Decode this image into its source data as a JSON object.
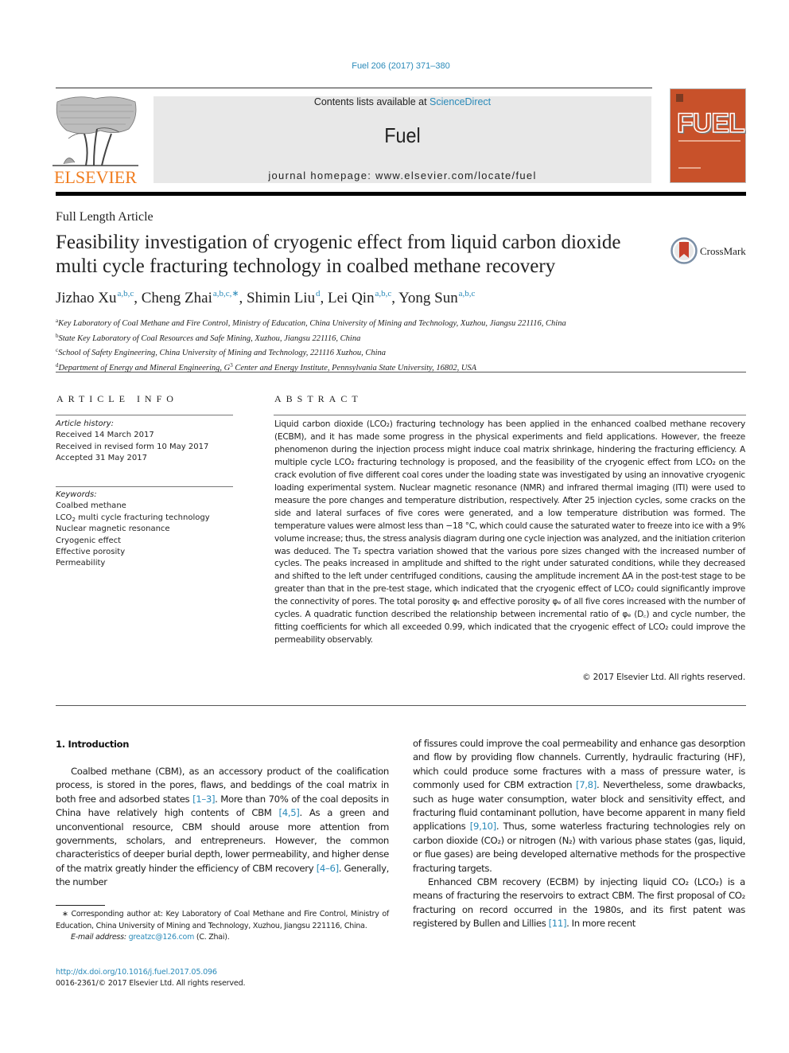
{
  "header": {
    "citation": "Fuel 206 (2017) 371–380",
    "contents_prefix": "Contents lists available at ",
    "contents_link": "ScienceDirect",
    "journal_name": "Fuel",
    "homepage_prefix": "journal homepage: ",
    "homepage_url": "www.elsevier.com/locate/fuel",
    "publisher_logo_text": "ELSEVIER",
    "cover_title": "FUEL",
    "colors": {
      "link": "#2a8ab9",
      "elsevier_orange": "#f07c1e",
      "cover": "#c8512a",
      "banner_bg": "#e8e8e8"
    }
  },
  "article": {
    "type": "Full Length Article",
    "title_line1": "Feasibility investigation of cryogenic effect from liquid carbon dioxide",
    "title_line2": "multi cycle fracturing technology in coalbed methane recovery",
    "crossmark_label": "CrossMark",
    "authors": [
      {
        "name": "Jizhao Xu",
        "sup": "a,b,c"
      },
      {
        "name": "Cheng Zhai",
        "sup": "a,b,c,",
        "corresponding": "∗"
      },
      {
        "name": "Shimin Liu",
        "sup": "d"
      },
      {
        "name": "Lei Qin",
        "sup": "a,b,c"
      },
      {
        "name": "Yong Sun",
        "sup": "a,b,c"
      }
    ],
    "affiliations": [
      {
        "key": "a",
        "text": "Key Laboratory of Coal Methane and Fire Control, Ministry of Education, China University of Mining and Technology, Xuzhou, Jiangsu 221116, China"
      },
      {
        "key": "b",
        "text": "State Key Laboratory of Coal Resources and Safe Mining, Xuzhou, Jiangsu 221116, China"
      },
      {
        "key": "c",
        "text": "School of Safety Engineering, China University of Mining and Technology, 221116 Xuzhou, China"
      },
      {
        "key": "d",
        "text_pre": "Department of Energy and Mineral Engineering, G",
        "text_sup": "3",
        "text_post": " Center and Energy Institute, Pennsylvania State University, 16802, USA"
      }
    ]
  },
  "article_info": {
    "heading": "ARTICLE INFO",
    "history_label": "Article history:",
    "history": [
      "Received 14 March 2017",
      "Received in revised form 10 May 2017",
      "Accepted 31 May 2017"
    ],
    "keywords_label": "Keywords:",
    "keywords": [
      "Coalbed methane",
      "LCO2 multi cycle fracturing technology",
      "Nuclear magnetic resonance",
      "Cryogenic effect",
      "Effective porosity",
      "Permeability"
    ]
  },
  "abstract": {
    "heading": "ABSTRACT",
    "text": "Liquid carbon dioxide (LCO₂) fracturing technology has been applied in the enhanced coalbed methane recovery (ECBM), and it has made some progress in the physical experiments and field applications. However, the freeze phenomenon during the injection process might induce coal matrix shrinkage, hindering the fracturing efficiency. A multiple cycle LCO₂ fracturing technology is proposed, and the feasibility of the cryogenic effect from LCO₂ on the crack evolution of five different coal cores under the loading state was investigated by using an innovative cryogenic loading experimental system. Nuclear magnetic resonance (NMR) and infrared thermal imaging (ITI) were used to measure the pore changes and temperature distribution, respectively. After 25 injection cycles, some cracks on the side and lateral surfaces of five cores were generated, and a low temperature distribution was formed. The temperature values were almost less than −18 °C, which could cause the saturated water to freeze into ice with a 9% volume increase; thus, the stress analysis diagram during one cycle injection was analyzed, and the initiation criterion was deduced. The T₂ spectra variation showed that the various pore sizes changed with the increased number of cycles. The peaks increased in amplitude and shifted to the right under saturated conditions, while they decreased and shifted to the left under centrifuged conditions, causing the amplitude increment ΔA in the post-test stage to be greater than that in the pre-test stage, which indicated that the cryogenic effect of LCO₂ could significantly improve the connectivity of pores. The total porosity φₜ and effective porosity φₑ of all five cores increased with the number of cycles. A quadratic function described the relationship between incremental ratio of φₑ (D꜀) and cycle number, the fitting coefficients for which all exceeded 0.99, which indicated that the cryogenic effect of LCO₂ could improve the permeability observably.",
    "copyright": "© 2017 Elsevier Ltd. All rights reserved."
  },
  "body": {
    "section_heading": "1. Introduction",
    "left_para": [
      {
        "t": "Coalbed methane (CBM), as an accessory product of the coalification process, is stored in the pores, flaws, and beddings of the coal matrix in both free and adsorbed states "
      },
      {
        "ref": "[1–3]"
      },
      {
        "t": ". More than 70% of the coal deposits in China have relatively high contents of CBM "
      },
      {
        "ref": "[4,5]"
      },
      {
        "t": ". As a green and unconventional resource, CBM should arouse more attention from governments, scholars, and entrepreneurs. However, the common characteristics of deeper burial depth, lower permeability, and higher dense of the matrix greatly hinder the efficiency of CBM recovery "
      },
      {
        "ref": "[4–6]"
      },
      {
        "t": ". Generally, the number"
      }
    ],
    "right_para1": [
      {
        "t": "of fissures could improve the coal permeability and enhance gas desorption and flow by providing flow channels. Currently, hydraulic fracturing (HF), which could produce some fractures with a mass of pressure water, is commonly used for CBM extraction "
      },
      {
        "ref": "[7,8]"
      },
      {
        "t": ". Nevertheless, some drawbacks, such as huge water consumption, water block and sensitivity effect, and fracturing fluid contaminant pollution, have become apparent in many field applications "
      },
      {
        "ref": "[9,10]"
      },
      {
        "t": ". Thus, some waterless fracturing technologies rely on carbon dioxide (CO₂) or nitrogen (N₂) with various phase states (gas, liquid, or flue gases) are being developed alternative methods for the prospective fracturing targets."
      }
    ],
    "right_para2": [
      {
        "t": "Enhanced CBM recovery (ECBM) by injecting liquid CO₂ (LCO₂) is a means of fracturing the reservoirs to extract CBM. The first proposal of CO₂ fracturing on record occurred in the 1980s, and its first patent was registered by Bullen and Lillies "
      },
      {
        "ref": "[11]"
      },
      {
        "t": ". In more recent"
      }
    ]
  },
  "footnote": {
    "corresponding": "∗ Corresponding author at: Key Laboratory of Coal Methane and Fire Control, Ministry of Education, China University of Mining and Technology, Xuzhou, Jiangsu 221116, China.",
    "email_label": "E-mail address: ",
    "email": "greatzc@126.com",
    "email_suffix": " (C. Zhai).",
    "doi": "http://dx.doi.org/10.1016/j.fuel.2017.05.096",
    "issn": "0016-2361/© 2017 Elsevier Ltd. All rights reserved."
  }
}
